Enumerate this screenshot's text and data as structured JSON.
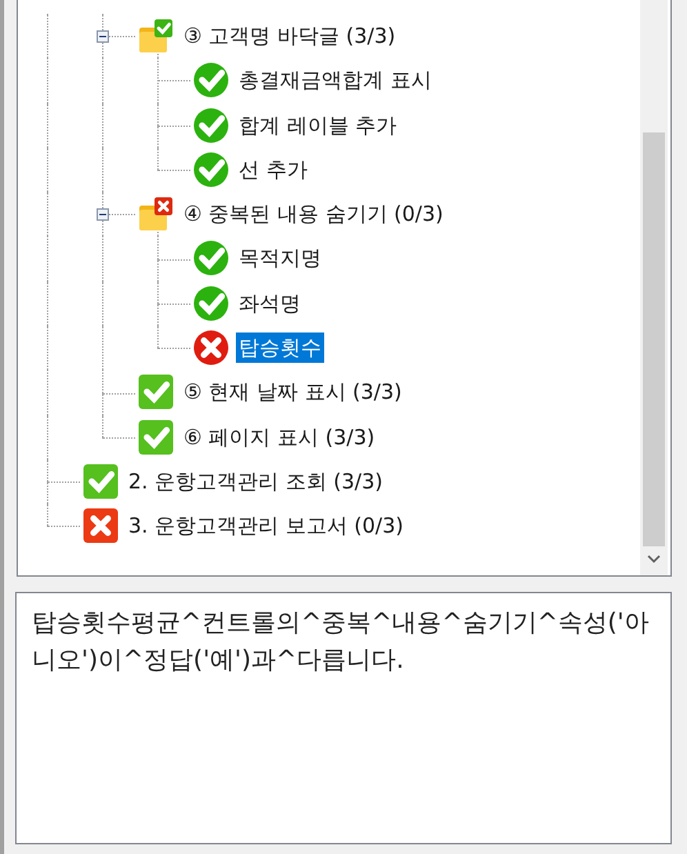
{
  "tree": {
    "items": [
      {
        "kind": "hidden",
        "children": [
          {
            "kind": "group",
            "label": "③ 고객명 바닥글 (3/3)",
            "passed": true,
            "expanded": true,
            "selected": false,
            "children": [
              {
                "kind": "leaf",
                "label": "총결재금액합계 표시",
                "passed": true,
                "selected": false
              },
              {
                "kind": "leaf",
                "label": "합계 레이블 추가",
                "passed": true,
                "selected": false
              },
              {
                "kind": "leaf",
                "label": "선 추가",
                "passed": true,
                "selected": false
              }
            ]
          },
          {
            "kind": "group",
            "label": "④ 중복된 내용 숨기기 (0/3)",
            "passed": false,
            "expanded": true,
            "selected": false,
            "children": [
              {
                "kind": "leaf",
                "label": "목적지명",
                "passed": true,
                "selected": false
              },
              {
                "kind": "leaf",
                "label": "좌석명",
                "passed": true,
                "selected": false
              },
              {
                "kind": "leaf",
                "label": "탑승횟수",
                "passed": false,
                "selected": true
              }
            ]
          },
          {
            "kind": "section",
            "label": "⑤ 현재 날짜 표시 (3/3)",
            "passed": true,
            "selected": false
          },
          {
            "kind": "section",
            "label": "⑥ 페이지 표시 (3/3)",
            "passed": true,
            "selected": false
          }
        ]
      },
      {
        "kind": "section",
        "label": "2. 운항고객관리 조회 (3/3)",
        "passed": true,
        "selected": false
      },
      {
        "kind": "section",
        "label": "3. 운항고객관리 보고서 (0/3)",
        "passed": false,
        "selected": false
      }
    ]
  },
  "message": "탑승횟수평균^컨트롤의^중복^내용^숨기기^속성('아니오')이^정답('예')과^다릅니다."
}
